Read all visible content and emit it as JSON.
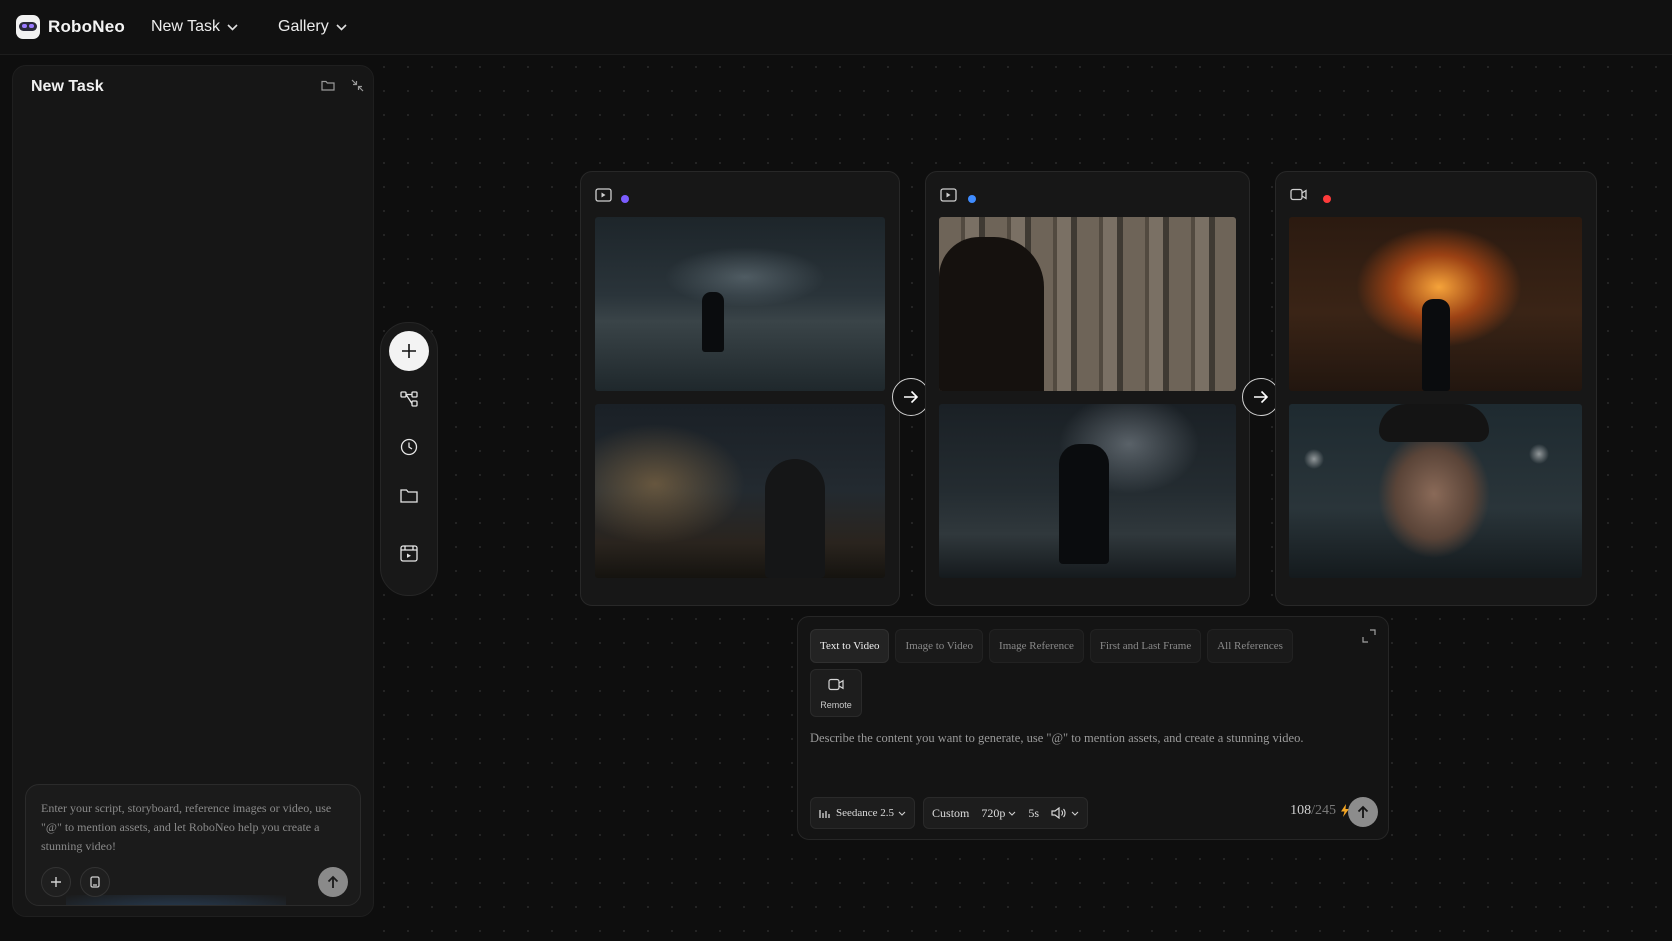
{
  "app": {
    "name": "RoboNeo"
  },
  "nav": {
    "task_label": "New Task",
    "gallery_label": "Gallery"
  },
  "panel": {
    "title": "New Task",
    "chat_placeholder": "Enter your script, storyboard, reference images or video, use \"@\" to mention assets, and let RoboNeo help you create a stunning video!"
  },
  "cards": [
    {
      "dot_color": "#7b5cff",
      "icon": "image-to-video-icon"
    },
    {
      "dot_color": "#3f8cff",
      "icon": "image-to-video-icon"
    },
    {
      "dot_color": "#ff3b3b",
      "icon": "video-icon"
    }
  ],
  "composer": {
    "tabs": [
      "Text to Video",
      "Image to Video",
      "Image Reference",
      "First and Last Frame",
      "All References"
    ],
    "active_tab": "Text to Video",
    "remote_label": "Remote",
    "prompt_placeholder": "Describe the content you want to generate, use \"@\" to mention assets, and create a stunning video.",
    "model": "Seedance 2.5",
    "ratio": "Custom",
    "resolution": "720p",
    "duration": "5s",
    "credits_used": "108",
    "credits_total": "/245"
  },
  "colors": {
    "background": "#0e0e0e",
    "panel": "#161616",
    "accent_bolt": "#f5a623"
  }
}
